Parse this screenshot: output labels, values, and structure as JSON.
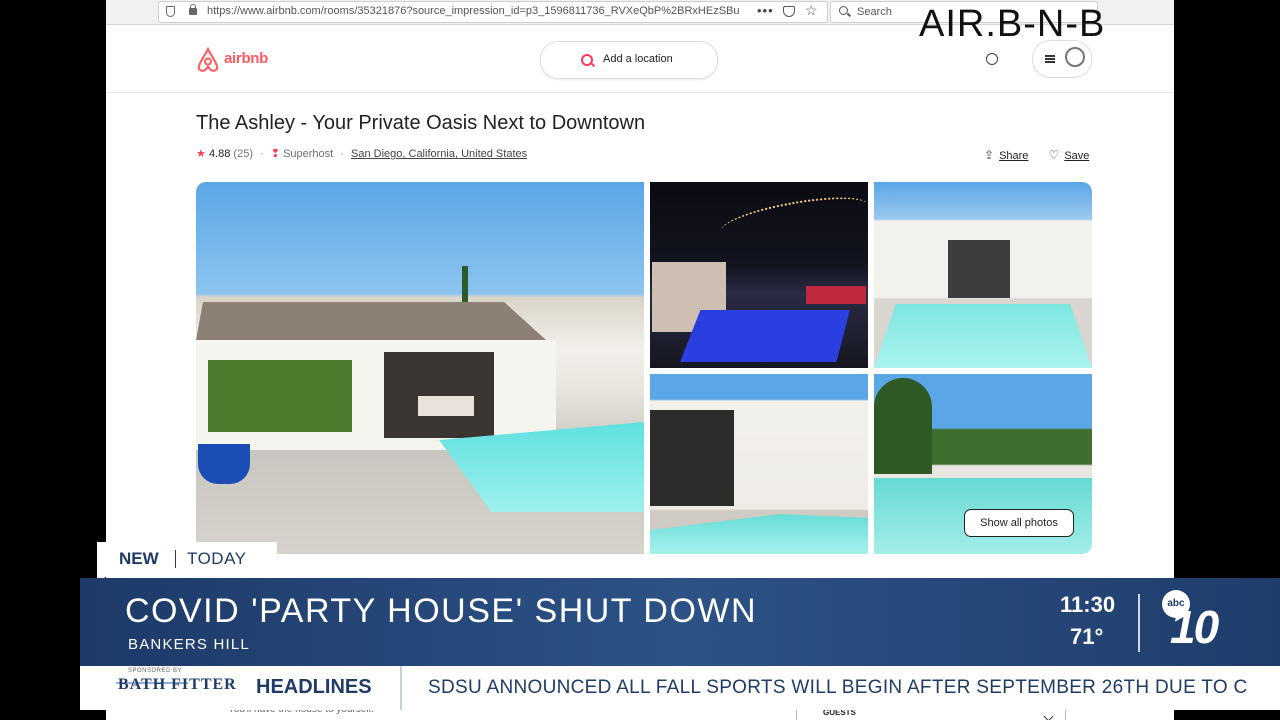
{
  "browser": {
    "url": "https://www.airbnb.com/rooms/35321876?source_impression_id=p3_1596811736_RVXeQbP%2BRxHEzSBu",
    "more_label": "•••",
    "search_placeholder": "Search"
  },
  "airbnb": {
    "logo_text": "airbnb",
    "location_button": "Add a location"
  },
  "overlay_title": "AIR.B-N-B",
  "listing": {
    "title": "The Ashley - Your Private Oasis Next to Downtown",
    "rating": "4.88",
    "reviews": "(25)",
    "superhost": "Superhost",
    "location": "San Diego, California, United States",
    "share_label": "Share",
    "save_label": "Save",
    "show_photos_label": "Show all photos",
    "below_text": "You'll have the house to yourself.",
    "guests_label": "GUESTS"
  },
  "news": {
    "tag_new": "NEW",
    "tag_today": "TODAY",
    "headline": "COVID 'PARTY HOUSE' SHUT DOWN",
    "subhead": "BANKERS HILL",
    "time": "11:30",
    "temperature": "71°",
    "station_abc": "abc",
    "station_number": "10",
    "sponsor_small": "SPONSORED BY",
    "sponsor": "BATH FITTER",
    "ticker_label": "HEADLINES",
    "ticker_story": "SDSU ANNOUNCED ALL FALL SPORTS WILL BEGIN AFTER SEPTEMBER 26TH DUE TO C"
  },
  "colors": {
    "brand": "#ff5a5f",
    "news_blue": "#1f3b66"
  }
}
